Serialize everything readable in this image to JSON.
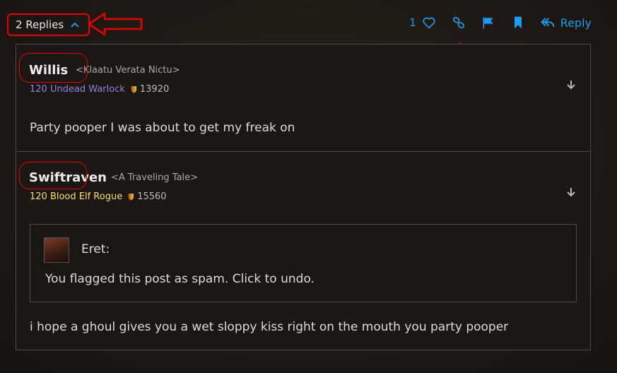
{
  "replies": {
    "label": "2 Replies"
  },
  "actions": {
    "like_count": "1",
    "reply_label": "Reply",
    "accent": "#1d9bf0"
  },
  "posts": [
    {
      "author": "Willis",
      "guild": "<Klaatu Verata Nictu>",
      "character": "120 Undead Warlock",
      "class_color": "#8f83de",
      "achievement_points": "13920",
      "body": "Party pooper I was about to get my freak on"
    },
    {
      "author": "Swiftraven",
      "guild": "<A Traveling Tale>",
      "character": "120 Blood Elf Rogue",
      "class_color": "#f3e06a",
      "achievement_points": "15560",
      "quote": {
        "name": "Eret:",
        "text": "You flagged this post as spam. Click to undo."
      },
      "body": "i hope a ghoul gives you a wet sloppy kiss right on the mouth you party pooper"
    }
  ],
  "annotation_color": "#e00000"
}
